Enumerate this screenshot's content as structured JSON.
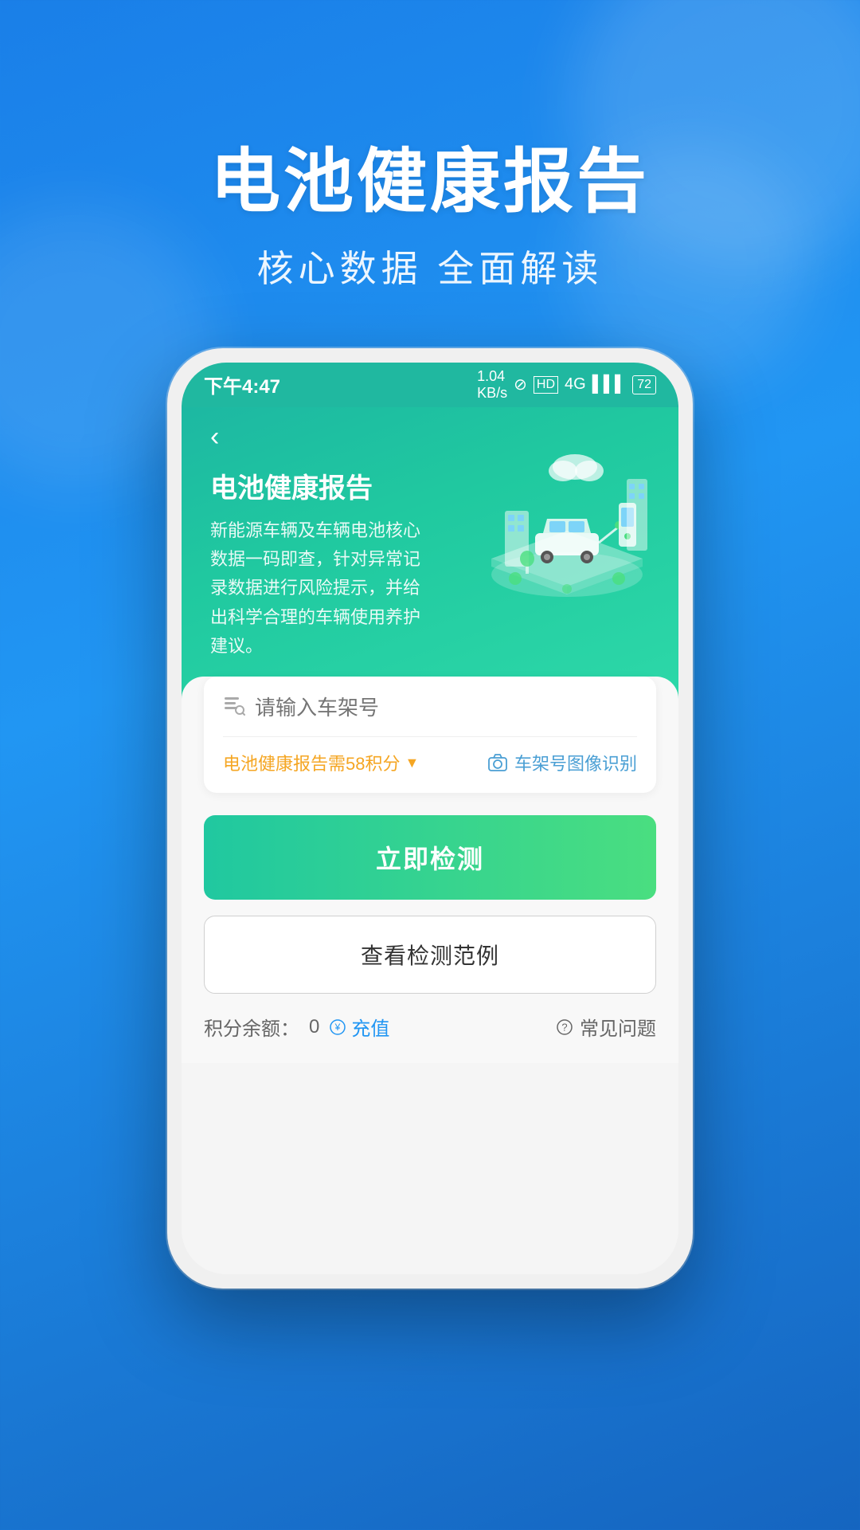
{
  "background": {
    "gradient_start": "#1a7fe8",
    "gradient_end": "#1565c0"
  },
  "page_header": {
    "title": "电池健康报告",
    "subtitle": "核心数据 全面解读"
  },
  "status_bar": {
    "time": "下午4:47",
    "signal_info": "1.04 KB/s",
    "battery": "72"
  },
  "app_header": {
    "back_label": "‹",
    "title": "电池健康报告",
    "description": "新能源车辆及车辆电池核心数据一码即查，针对异常记录数据进行风险提示，并给出科学合理的车辆使用养护建议。"
  },
  "search_section": {
    "placeholder": "请输入车架号",
    "points_label": "电池健康报告需58积分",
    "camera_label": "车架号图像识别"
  },
  "buttons": {
    "detect": "立即检测",
    "example": "查看检测范例"
  },
  "bottom": {
    "balance_label": "积分余额：",
    "balance_value": "0",
    "recharge_label": "充值",
    "faq_label": "常见问题"
  }
}
